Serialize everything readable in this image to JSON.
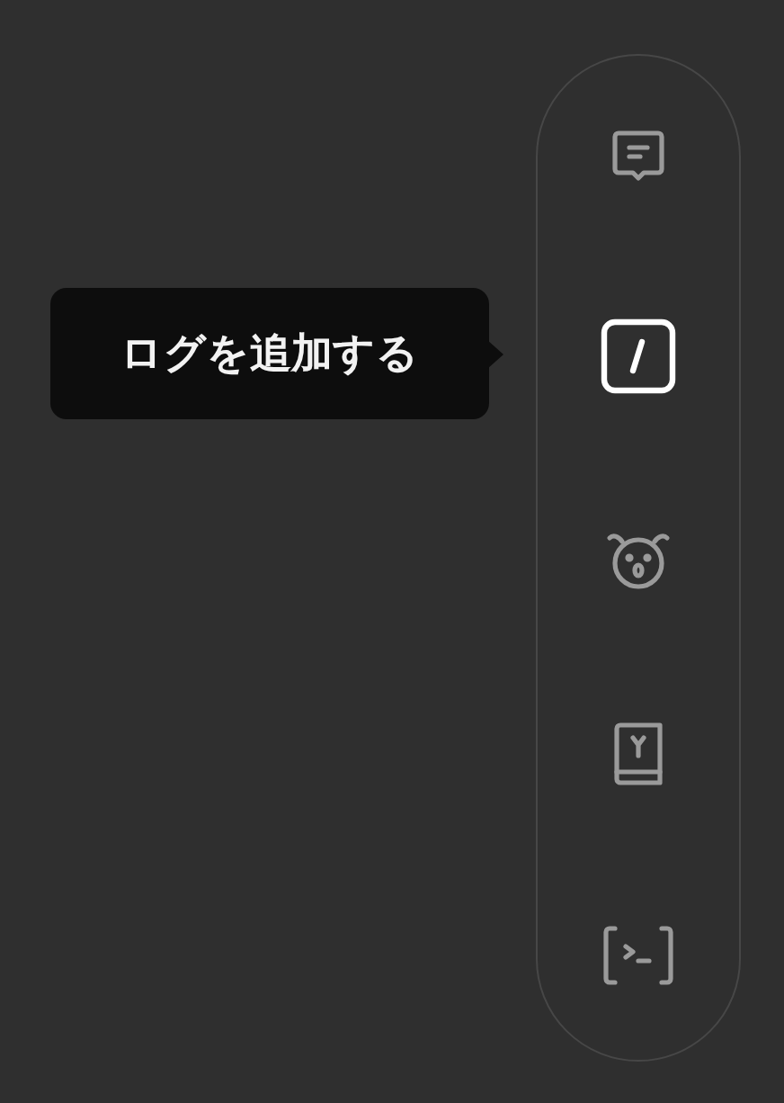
{
  "dock": {
    "items": [
      {
        "kind": "message",
        "selected": false
      },
      {
        "kind": "slash",
        "selected": true
      },
      {
        "kind": "bug",
        "selected": false
      },
      {
        "kind": "book",
        "selected": false
      },
      {
        "kind": "terminal",
        "selected": false
      }
    ]
  },
  "tooltip": {
    "text": "ログを追加する"
  }
}
